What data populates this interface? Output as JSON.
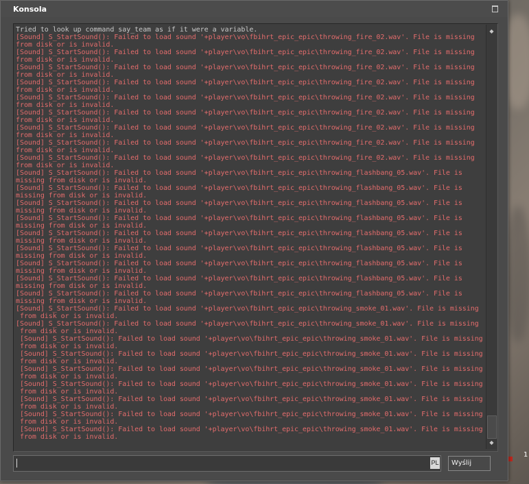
{
  "window": {
    "title": "Konsola"
  },
  "console": {
    "lines": [
      {
        "kind": "info",
        "text": "Tried to look up command say_team as if it were a variable."
      },
      {
        "kind": "err",
        "text": "[Sound] S_StartSound(): Failed to load sound '+player\\vo\\fbihrt_epic_epic\\throwing_fire_02.wav'. File is missing"
      },
      {
        "kind": "err",
        "text": "from disk or is invalid."
      },
      {
        "kind": "err",
        "text": "[Sound] S_StartSound(): Failed to load sound '+player\\vo\\fbihrt_epic_epic\\throwing_fire_02.wav'. File is missing"
      },
      {
        "kind": "err",
        "text": "from disk or is invalid."
      },
      {
        "kind": "err",
        "text": "[Sound] S_StartSound(): Failed to load sound '+player\\vo\\fbihrt_epic_epic\\throwing_fire_02.wav'. File is missing"
      },
      {
        "kind": "err",
        "text": "from disk or is invalid."
      },
      {
        "kind": "err",
        "text": "[Sound] S_StartSound(): Failed to load sound '+player\\vo\\fbihrt_epic_epic\\throwing_fire_02.wav'. File is missing"
      },
      {
        "kind": "err",
        "text": "from disk or is invalid."
      },
      {
        "kind": "err",
        "text": "[Sound] S_StartSound(): Failed to load sound '+player\\vo\\fbihrt_epic_epic\\throwing_fire_02.wav'. File is missing"
      },
      {
        "kind": "err",
        "text": "from disk or is invalid."
      },
      {
        "kind": "err",
        "text": "[Sound] S_StartSound(): Failed to load sound '+player\\vo\\fbihrt_epic_epic\\throwing_fire_02.wav'. File is missing"
      },
      {
        "kind": "err",
        "text": "from disk or is invalid."
      },
      {
        "kind": "err",
        "text": "[Sound] S_StartSound(): Failed to load sound '+player\\vo\\fbihrt_epic_epic\\throwing_fire_02.wav'. File is missing"
      },
      {
        "kind": "err",
        "text": "from disk or is invalid."
      },
      {
        "kind": "err",
        "text": "[Sound] S_StartSound(): Failed to load sound '+player\\vo\\fbihrt_epic_epic\\throwing_fire_02.wav'. File is missing"
      },
      {
        "kind": "err",
        "text": "from disk or is invalid."
      },
      {
        "kind": "err",
        "text": "[Sound] S_StartSound(): Failed to load sound '+player\\vo\\fbihrt_epic_epic\\throwing_fire_02.wav'. File is missing"
      },
      {
        "kind": "err",
        "text": "from disk or is invalid."
      },
      {
        "kind": "err",
        "text": "[Sound] S_StartSound(): Failed to load sound '+player\\vo\\fbihrt_epic_epic\\throwing_flashbang_05.wav'. File is"
      },
      {
        "kind": "err",
        "text": "missing from disk or is invalid."
      },
      {
        "kind": "err",
        "text": "[Sound] S_StartSound(): Failed to load sound '+player\\vo\\fbihrt_epic_epic\\throwing_flashbang_05.wav'. File is"
      },
      {
        "kind": "err",
        "text": "missing from disk or is invalid."
      },
      {
        "kind": "err",
        "text": "[Sound] S_StartSound(): Failed to load sound '+player\\vo\\fbihrt_epic_epic\\throwing_flashbang_05.wav'. File is"
      },
      {
        "kind": "err",
        "text": "missing from disk or is invalid."
      },
      {
        "kind": "err",
        "text": "[Sound] S_StartSound(): Failed to load sound '+player\\vo\\fbihrt_epic_epic\\throwing_flashbang_05.wav'. File is"
      },
      {
        "kind": "err",
        "text": "missing from disk or is invalid."
      },
      {
        "kind": "err",
        "text": "[Sound] S_StartSound(): Failed to load sound '+player\\vo\\fbihrt_epic_epic\\throwing_flashbang_05.wav'. File is"
      },
      {
        "kind": "err",
        "text": "missing from disk or is invalid."
      },
      {
        "kind": "err",
        "text": "[Sound] S_StartSound(): Failed to load sound '+player\\vo\\fbihrt_epic_epic\\throwing_flashbang_05.wav'. File is"
      },
      {
        "kind": "err",
        "text": "missing from disk or is invalid."
      },
      {
        "kind": "err",
        "text": "[Sound] S_StartSound(): Failed to load sound '+player\\vo\\fbihrt_epic_epic\\throwing_flashbang_05.wav'. File is"
      },
      {
        "kind": "err",
        "text": "missing from disk or is invalid."
      },
      {
        "kind": "err",
        "text": "[Sound] S_StartSound(): Failed to load sound '+player\\vo\\fbihrt_epic_epic\\throwing_flashbang_05.wav'. File is"
      },
      {
        "kind": "err",
        "text": "missing from disk or is invalid."
      },
      {
        "kind": "err",
        "text": "[Sound] S_StartSound(): Failed to load sound '+player\\vo\\fbihrt_epic_epic\\throwing_flashbang_05.wav'. File is"
      },
      {
        "kind": "err",
        "text": "missing from disk or is invalid."
      },
      {
        "kind": "err",
        "text": "[Sound] S_StartSound(): Failed to load sound '+player\\vo\\fbihrt_epic_epic\\throwing_smoke_01.wav'. File is missing"
      },
      {
        "kind": "err",
        "text": " from disk or is invalid."
      },
      {
        "kind": "err",
        "text": "[Sound] S_StartSound(): Failed to load sound '+player\\vo\\fbihrt_epic_epic\\throwing_smoke_01.wav'. File is missing"
      },
      {
        "kind": "err",
        "text": " from disk or is invalid."
      },
      {
        "kind": "err",
        "text": " [Sound] S_StartSound(): Failed to load sound '+player\\vo\\fbihrt_epic_epic\\throwing_smoke_01.wav'. File is missing"
      },
      {
        "kind": "err",
        "text": " from disk or is invalid."
      },
      {
        "kind": "err",
        "text": " [Sound] S_StartSound(): Failed to load sound '+player\\vo\\fbihrt_epic_epic\\throwing_smoke_01.wav'. File is missing"
      },
      {
        "kind": "err",
        "text": " from disk or is invalid."
      },
      {
        "kind": "err",
        "text": " [Sound] S_StartSound(): Failed to load sound '+player\\vo\\fbihrt_epic_epic\\throwing_smoke_01.wav'. File is missing"
      },
      {
        "kind": "err",
        "text": " from disk or is invalid."
      },
      {
        "kind": "err",
        "text": " [Sound] S_StartSound(): Failed to load sound '+player\\vo\\fbihrt_epic_epic\\throwing_smoke_01.wav'. File is missing"
      },
      {
        "kind": "err",
        "text": " from disk or is invalid."
      },
      {
        "kind": "err",
        "text": " [Sound] S_StartSound(): Failed to load sound '+player\\vo\\fbihrt_epic_epic\\throwing_smoke_01.wav'. File is missing"
      },
      {
        "kind": "err",
        "text": " from disk or is invalid."
      },
      {
        "kind": "err",
        "text": " [Sound] S_StartSound(): Failed to load sound '+player\\vo\\fbihrt_epic_epic\\throwing_smoke_01.wav'. File is missing"
      },
      {
        "kind": "err",
        "text": " from disk or is invalid."
      },
      {
        "kind": "err",
        "text": " [Sound] S_StartSound(): Failed to load sound '+player\\vo\\fbihrt_epic_epic\\throwing_smoke_01.wav'. File is missing"
      },
      {
        "kind": "err",
        "text": " from disk or is invalid."
      }
    ]
  },
  "input": {
    "value": "",
    "language_indicator": "PL"
  },
  "buttons": {
    "send_label": "Wyślij"
  },
  "background": {
    "corner_digit": "1"
  },
  "colors": {
    "info_text": "#c9c9c9",
    "error_text": "#e36c6c",
    "window_bg": "#4a4a4a"
  }
}
